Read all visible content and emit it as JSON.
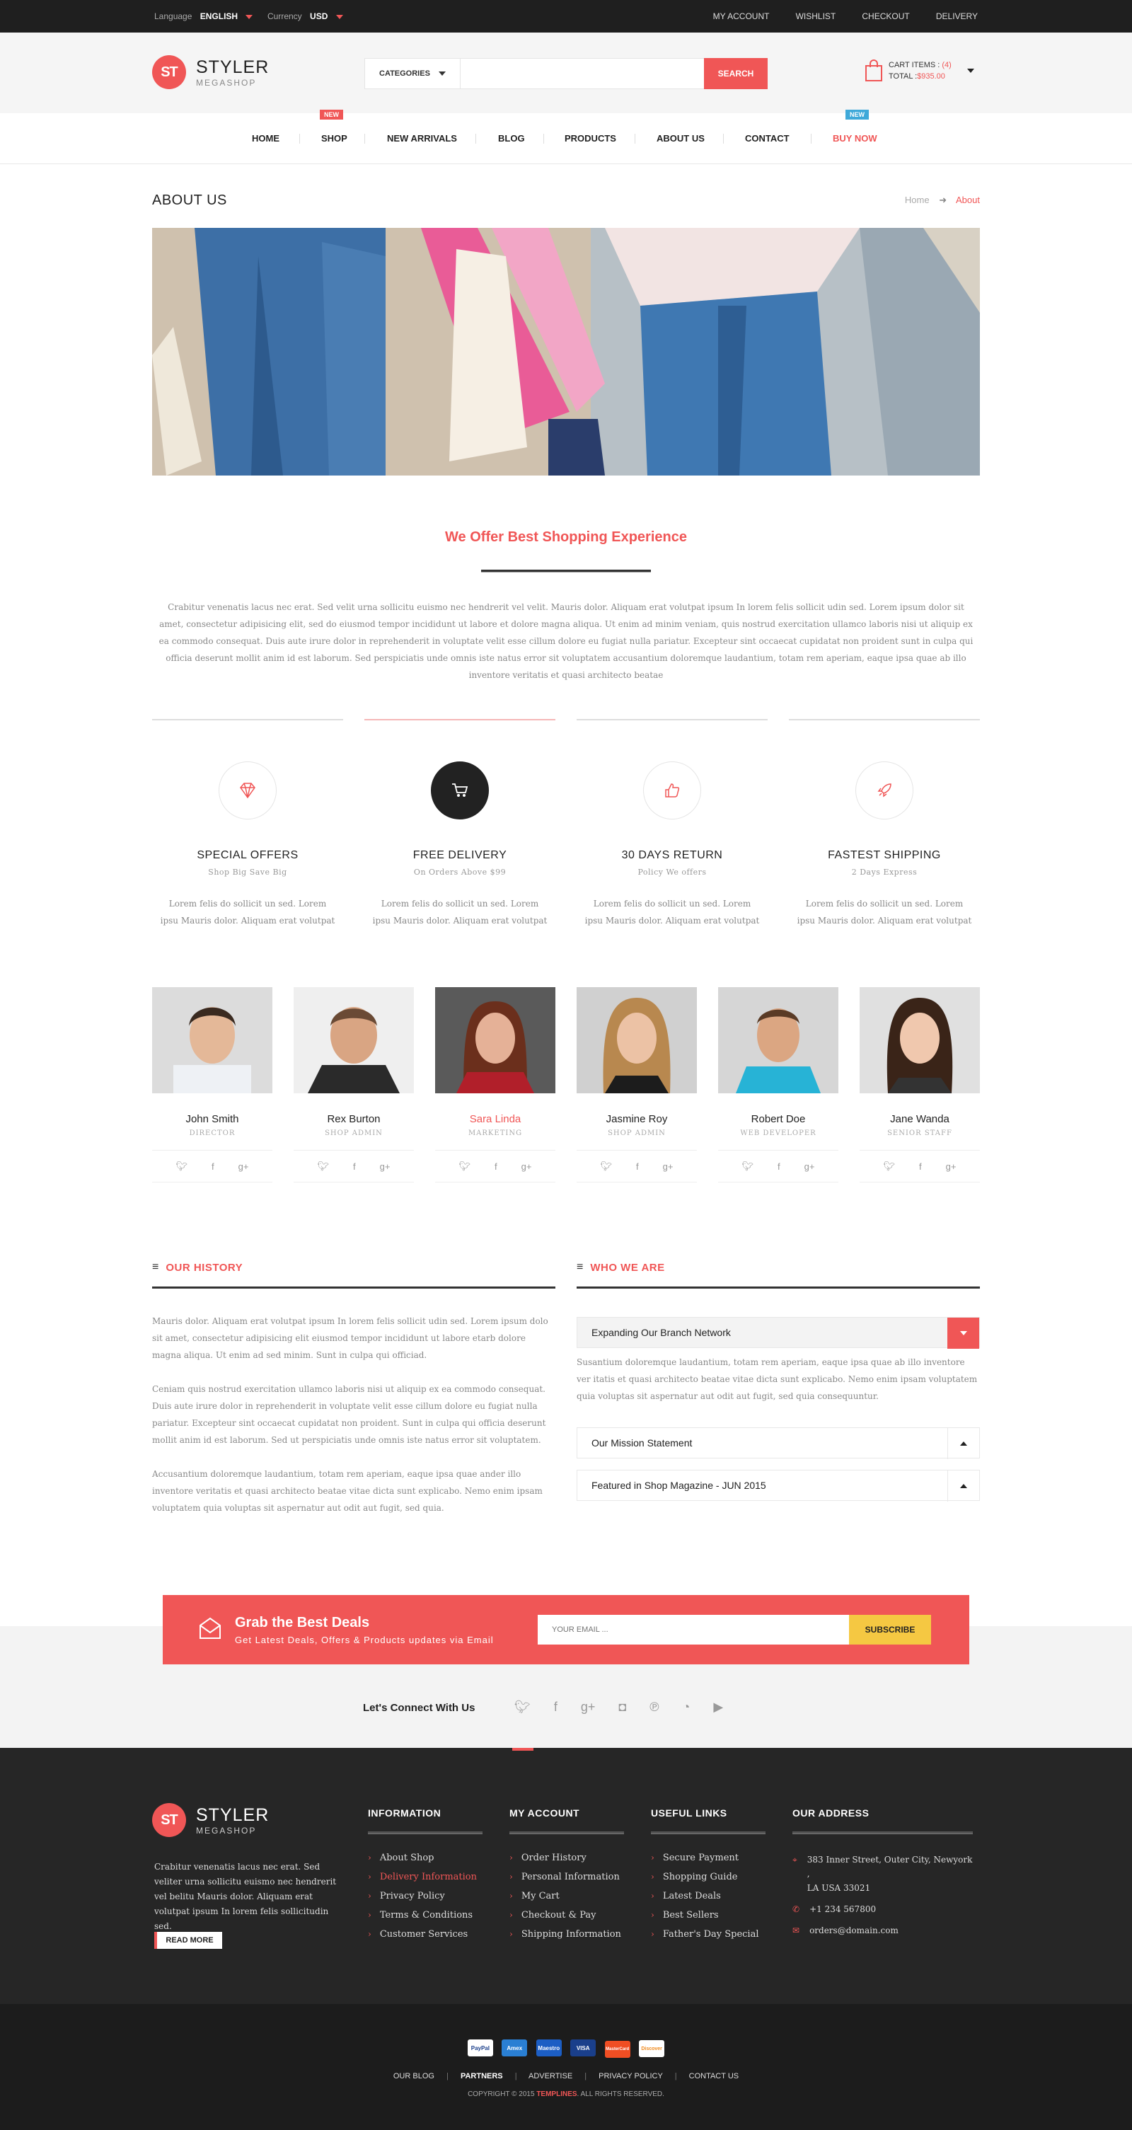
{
  "topbar": {
    "language_label": "Language",
    "language_value": "ENGLISH",
    "currency_label": "Currency",
    "currency_value": "USD",
    "links": [
      "MY ACCOUNT",
      "WISHLIST",
      "CHECKOUT",
      "DELIVERY"
    ]
  },
  "logo": {
    "mark": "ST",
    "title": "STYLER",
    "subtitle": "MEGASHOP"
  },
  "search": {
    "category_label": "CATEGORIES",
    "button": "SEARCH"
  },
  "cart": {
    "items_label": "CART ITEMS :",
    "items_count": "(4)",
    "total_label": "TOTAL :",
    "total_value": "$935.00"
  },
  "nav": {
    "items": [
      "HOME",
      "SHOP",
      "NEW ARRIVALS",
      "BLOG",
      "PRODUCTS",
      "ABOUT US",
      "CONTACT",
      "BUY NOW"
    ],
    "badge_shop": "NEW",
    "badge_buynow": "NEW"
  },
  "page": {
    "title": "ABOUT US",
    "breadcrumb_home": "Home",
    "breadcrumb_current": "About"
  },
  "intro": {
    "heading": "We Offer Best Shopping Experience",
    "text": "Crabitur venenatis lacus nec erat. Sed velit urna sollicitu euismo nec hendrerit vel velit. Mauris dolor. Aliquam erat volutpat ipsum In lorem felis sollicit udin sed. Lorem ipsum dolor sit amet, consectetur adipisicing elit, sed do eiusmod tempor incididunt ut labore et dolore magna aliqua. Ut enim ad minim veniam, quis nostrud exercitation ullamco laboris nisi ut aliquip ex ea commodo consequat. Duis aute irure dolor in reprehenderit in voluptate velit esse cillum dolore eu fugiat nulla pariatur. Excepteur sint occaecat cupidatat non proident sunt in culpa qui officia deserunt mollit anim id est laborum. Sed perspiciatis unde omnis iste natus error sit voluptatem accusantium doloremque laudantium, totam rem aperiam, eaque ipsa quae ab illo inventore veritatis et quasi architecto beatae"
  },
  "features": [
    {
      "icon": "diamond-icon",
      "title": "SPECIAL OFFERS",
      "sub": "Shop Big Save Big",
      "desc": "Lorem felis do sollicit un sed. Lorem ipsu Mauris dolor. Aliquam erat volutpat"
    },
    {
      "icon": "cart-icon",
      "title": "FREE DELIVERY",
      "sub": "On Orders Above $99",
      "desc": "Lorem felis do sollicit un sed. Lorem ipsu Mauris dolor. Aliquam erat volutpat"
    },
    {
      "icon": "thumbs-up-icon",
      "title": "30 DAYS RETURN",
      "sub": "Policy We offers",
      "desc": "Lorem felis do sollicit un sed. Lorem ipsu Mauris dolor. Aliquam erat volutpat"
    },
    {
      "icon": "rocket-icon",
      "title": "FASTEST SHIPPING",
      "sub": "2 Days Express",
      "desc": "Lorem felis do sollicit un sed. Lorem ipsu Mauris dolor. Aliquam erat volutpat"
    }
  ],
  "team": [
    {
      "name": "John Smith",
      "role": "DIRECTOR"
    },
    {
      "name": "Rex Burton",
      "role": "SHOP ADMIN"
    },
    {
      "name": "Sara Linda",
      "role": "MARKETING"
    },
    {
      "name": "Jasmine Roy",
      "role": "SHOP ADMIN"
    },
    {
      "name": "Robert Doe",
      "role": "WEB DEVELOPER"
    },
    {
      "name": "Jane Wanda",
      "role": "SENIOR STAFF"
    }
  ],
  "history": {
    "heading": "OUR HISTORY",
    "p1": "Mauris dolor. Aliquam erat volutpat ipsum In lorem felis sollicit udin sed. Lorem ipsum dolo  sit amet, consectetur adipisicing elit eiusmod tempor incididunt ut labore etarb dolore magna aliqua. Ut enim ad sed minim. Sunt in culpa qui officiad.",
    "p2": "Ceniam quis nostrud exercitation ullamco laboris nisi ut aliquip ex ea commodo consequat. Duis aute irure dolor in reprehenderit in voluptate velit esse cillum dolore eu fugiat nulla pariatur. Excepteur sint occaecat cupidatat non proident. Sunt in culpa qui officia deserunt mollit anim id est laborum. Sed ut perspiciatis unde omnis iste natus error sit voluptatem.",
    "p3": "Accusantium doloremque laudantium, totam rem aperiam, eaque ipsa quae ander illo inventore veritatis et quasi architecto beatae vitae dicta sunt explicabo. Nemo enim ipsam voluptatem quia voluptas sit aspernatur aut odit aut fugit, sed quia."
  },
  "who": {
    "heading": "WHO WE ARE",
    "acc1_title": "Expanding Our Branch Network",
    "acc1_text": "Susantium doloremque laudantium, totam rem aperiam, eaque ipsa quae ab illo inventore ver itatis et quasi architecto beatae vitae dicta sunt explicabo. Nemo enim ipsam voluptatem quia voluptas sit aspernatur aut odit aut fugit, sed quia consequuntur.",
    "acc2_title": "Our Mission Statement",
    "acc3_title": "Featured in Shop Magazine - JUN 2015"
  },
  "newsletter": {
    "title": "Grab the Best Deals",
    "subtitle": "Get Latest Deals, Offers & Products updates via Email",
    "placeholder": "YOUR EMAIL ...",
    "button": "SUBSCRIBE"
  },
  "connect": {
    "label": "Let's Connect With Us"
  },
  "footer": {
    "about": "Crabitur venenatis lacus nec erat. Sed veliter urna sollicitu euismo nec hendrerit vel belitu Mauris dolor. Aliquam erat volutpat ipsum In lorem felis sollicitudin sed.",
    "read_more": "READ MORE",
    "info_title": "INFORMATION",
    "info_links": [
      "About Shop",
      "Delivery Information",
      "Privacy Policy",
      "Terms & Conditions",
      "Customer Services"
    ],
    "account_title": "MY ACCOUNT",
    "account_links": [
      "Order History",
      "Personal Information",
      "My Cart",
      "Checkout & Pay",
      "Shipping Information"
    ],
    "useful_title": "USEFUL LINKS",
    "useful_links": [
      "Secure Payment",
      "Shopping Guide",
      "Latest Deals",
      "Best Sellers",
      "Father's Day Special"
    ],
    "address_title": "OUR ADDRESS",
    "address_line1": "383 Inner Street, Outer City, Newyork ,",
    "address_line2": "LA USA 33021",
    "phone": "+1 234 567800",
    "email": "orders@domain.com"
  },
  "bottom": {
    "payments": [
      "PayPal",
      "Amex",
      "Maestro",
      "VISA",
      "MasterCard",
      "Discover"
    ],
    "links": [
      "OUR BLOG",
      "PARTNERS",
      "ADVERTISE",
      "PRIVACY POLICY",
      "CONTACT US"
    ],
    "copyright_prefix": "COPYRIGHT © 2015",
    "copyright_brand": "TEMPLINES",
    "copyright_suffix": ". ALL RIGHTS RESERVED."
  },
  "colors": {
    "accent": "#f05656",
    "dark": "#1f1f1f",
    "yellow": "#f5c842"
  }
}
